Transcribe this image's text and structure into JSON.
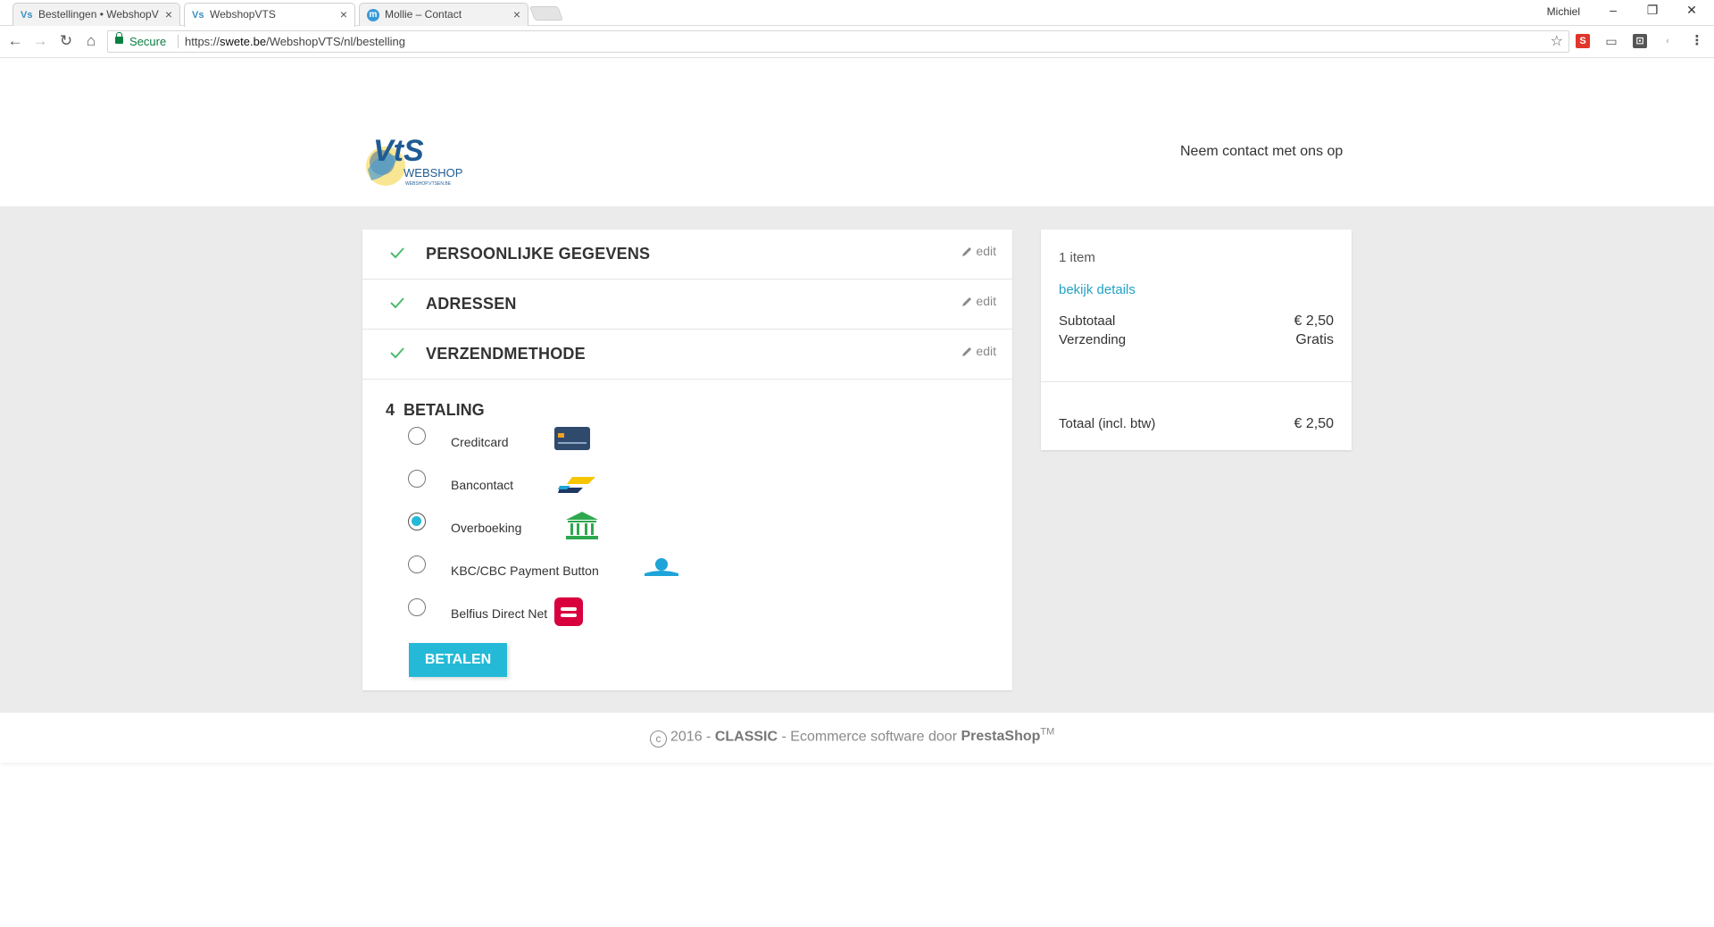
{
  "browser": {
    "tabs": [
      {
        "title": "Bestellingen • WebshopV",
        "favicon": "vts-favicon"
      },
      {
        "title": "WebshopVTS",
        "favicon": "vts-favicon"
      },
      {
        "title": "Mollie – Contact",
        "favicon": "m"
      }
    ],
    "user": "Michiel",
    "secure_label": "Secure",
    "url_scheme": "https://",
    "url_host": "swete.be",
    "url_path": "/WebshopVTS/nl/bestelling",
    "extension_s": "S"
  },
  "header": {
    "logo_text": "VtS",
    "logo_sub": "WEBSHOP",
    "logo_url": "WEBSHOP.VTSEN.BE",
    "contact_link": "Neem contact met ons op"
  },
  "checkout": {
    "steps": [
      {
        "title": "PERSOONLIJKE GEGEVENS",
        "edit": "edit"
      },
      {
        "title": "ADRESSEN",
        "edit": "edit"
      },
      {
        "title": "VERZENDMETHODE",
        "edit": "edit"
      }
    ],
    "current_step": {
      "number": "4",
      "title": "BETALING"
    },
    "payment_options": [
      {
        "label": "Creditcard",
        "icon": "creditcard-icon",
        "selected": false
      },
      {
        "label": "Bancontact",
        "icon": "bancontact-icon",
        "selected": false
      },
      {
        "label": "Overboeking",
        "icon": "bank-icon",
        "selected": true
      },
      {
        "label": "KBC/CBC Payment Button",
        "icon": "kbc-icon",
        "selected": false
      },
      {
        "label": "Belfius Direct Net",
        "icon": "belfius-icon",
        "selected": false
      }
    ],
    "pay_button": "BETALEN"
  },
  "summary": {
    "items": "1 item",
    "details_link": "bekijk details",
    "subtotal_label": "Subtotaal",
    "subtotal_value": "€ 2,50",
    "shipping_label": "Verzending",
    "shipping_value": "Gratis",
    "total_label": "Totaal (incl. btw)",
    "total_value": "€ 2,50"
  },
  "footer": {
    "year": "2016 -",
    "theme": "CLASSIC",
    "text": "- Ecommerce software door",
    "brand": "PrestaShop",
    "tm": "TM"
  },
  "colors": {
    "accent": "#24b9d7",
    "check": "#4cbb6c",
    "background": "#ebebeb"
  }
}
